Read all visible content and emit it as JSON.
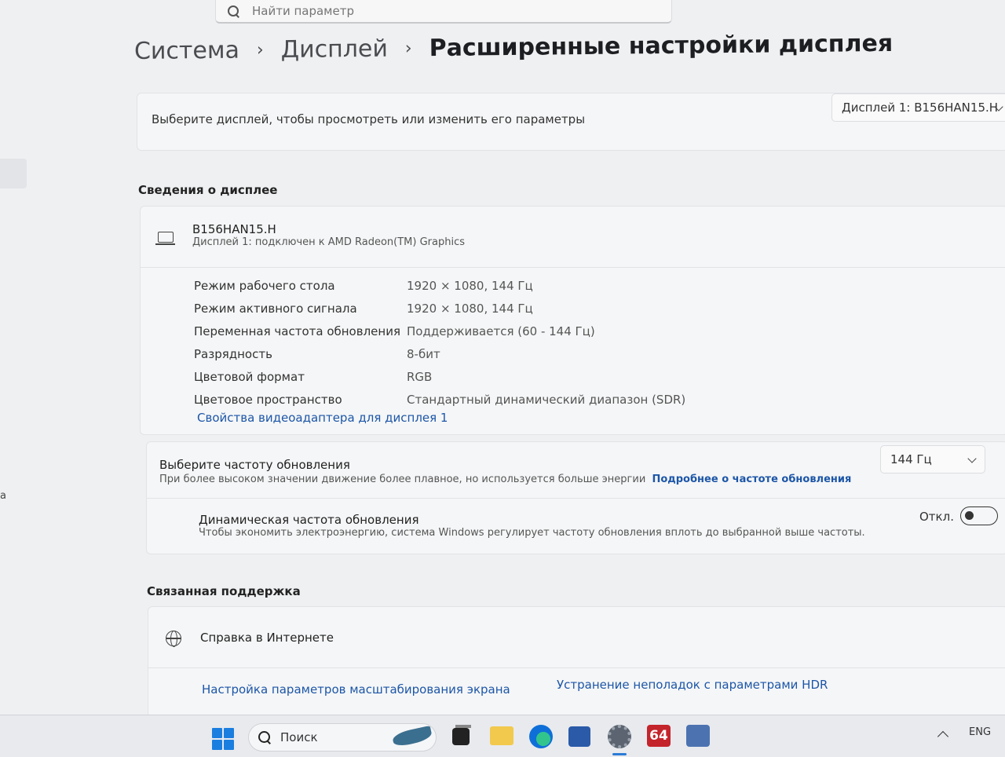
{
  "search": {
    "placeholder": "Найти параметр"
  },
  "breadcrumb": {
    "items": [
      "Система",
      "Дисплей"
    ],
    "current": "Расширенные настройки дисплея"
  },
  "display_select": {
    "label": "Выберите дисплей, чтобы просмотреть или изменить его параметры",
    "value": "Дисплей 1: B156HAN15.H"
  },
  "display_info": {
    "section_title": "Сведения о дисплее",
    "name": "B156HAN15.H",
    "subtitle": "Дисплей 1: подключен к AMD Radeon(TM) Graphics",
    "rows": [
      {
        "key": "Режим рабочего стола",
        "value": "1920 × 1080, 144 Гц"
      },
      {
        "key": "Режим активного сигнала",
        "value": "1920 × 1080, 144 Гц"
      },
      {
        "key": "Переменная частота обновления",
        "value": "Поддерживается (60 - 144 Гц)"
      },
      {
        "key": "Разрядность",
        "value": "8-бит"
      },
      {
        "key": "Цветовой формат",
        "value": "RGB"
      },
      {
        "key": "Цветовое пространство",
        "value": "Стандартный динамический диапазон (SDR)"
      }
    ],
    "adapter_link": "Свойства видеоадаптера для дисплея 1"
  },
  "refresh": {
    "title": "Выберите частоту обновления",
    "subtitle": "При более высоком значении движение более плавное, но используется больше энергии",
    "link": "Подробнее о частоте обновления",
    "value": "144 Гц",
    "dynamic_title": "Динамическая частота обновления",
    "dynamic_subtitle": "Чтобы экономить электроэнергию, система Windows регулирует частоту обновления вплоть до выбранной выше частоты.",
    "toggle_label": "Откл."
  },
  "support": {
    "section_title": "Связанная поддержка",
    "help_title": "Справка в Интернете",
    "link1": "Настройка параметров масштабирования экрана",
    "link2": "Устранение неполадок с параметрами HDR"
  },
  "taskbar": {
    "search_label": "Поиск",
    "aida_label": "64",
    "language": "ENG"
  },
  "sidebar": {
    "edge_letter": "a"
  }
}
